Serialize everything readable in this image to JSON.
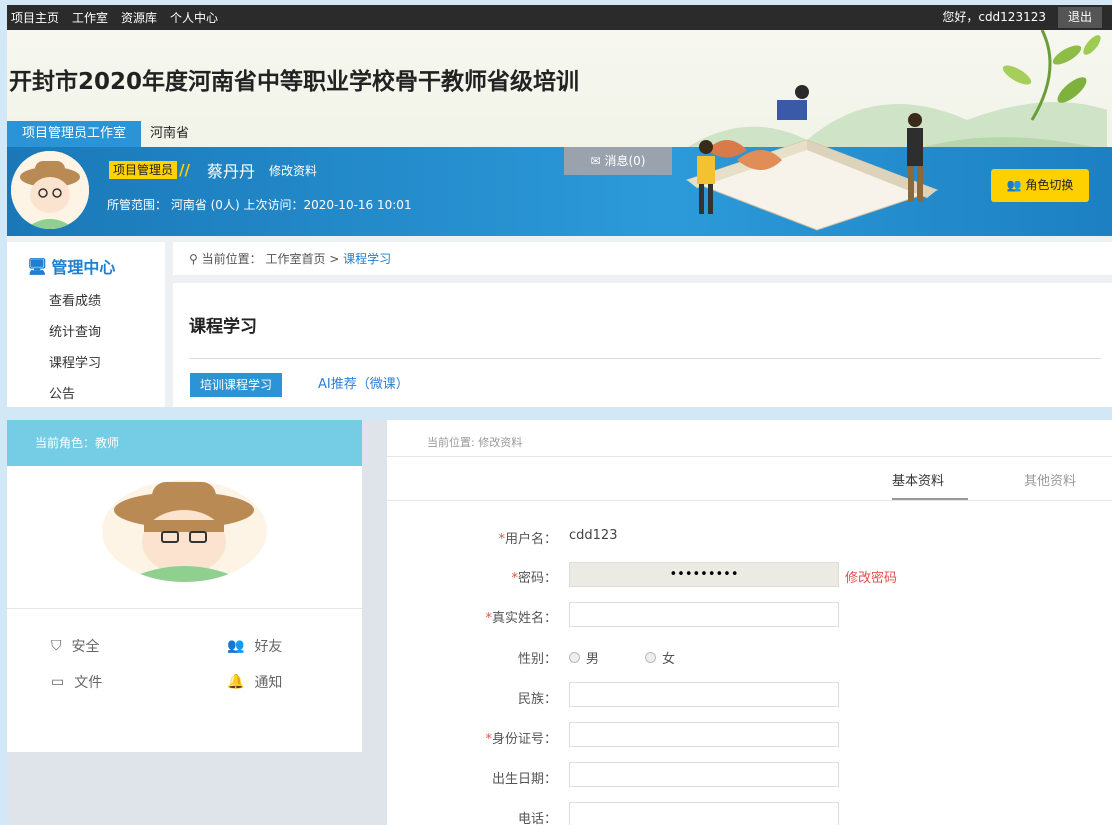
{
  "topnav": {
    "items": [
      "项目主页",
      "工作室",
      "资源库",
      "个人中心"
    ],
    "greeting": "您好，cdd123123",
    "logout": "退出"
  },
  "banner": {
    "title": "开封市2020年度河南省中等职业学校骨干教师省级培训",
    "studio_tab": "项目管理员工作室",
    "province": "河南省",
    "role_badge": "项目管理员",
    "user_name": "蔡丹丹",
    "edit_profile": "修改资料",
    "scope_text": "所管范围：  河南省 (0人) 上次访问：2020-10-16 10:01",
    "message": "消息(0)",
    "role_switch": "角色切换"
  },
  "sidebar": {
    "title": "管理中心",
    "items": [
      "查看成绩",
      "统计查询",
      "课程学习",
      "公告"
    ]
  },
  "main": {
    "breadcrumb_prefix": "当前位置：  工作室首页  >",
    "breadcrumb_current": "课程学习",
    "title": "课程学习",
    "tabs": [
      "培训课程学习",
      "AI推荐（微课）"
    ]
  },
  "profile": {
    "role_header": "当前角色：教师",
    "links": [
      "安全",
      "好友",
      "文件",
      "通知"
    ],
    "breadcrumb": "当前位置: 修改资料",
    "tabs": [
      "基本资料",
      "其他资料"
    ],
    "fields": {
      "username_label": "用户名：",
      "username_value": "cdd123",
      "password_label": "密码：",
      "password_value": "•••••••••",
      "change_password": "修改密码",
      "realname_label": "真实姓名：",
      "gender_label": "性别：",
      "gender_male": "男",
      "gender_female": "女",
      "ethnic_label": "民族：",
      "id_label": "身份证号：",
      "birth_label": "出生日期：",
      "phone_label": "电话："
    }
  },
  "colors": {
    "accent_blue": "#2b94d6",
    "badge_yellow": "#ffd200",
    "required_red": "#e0524a",
    "role_header": "#74cde4"
  }
}
